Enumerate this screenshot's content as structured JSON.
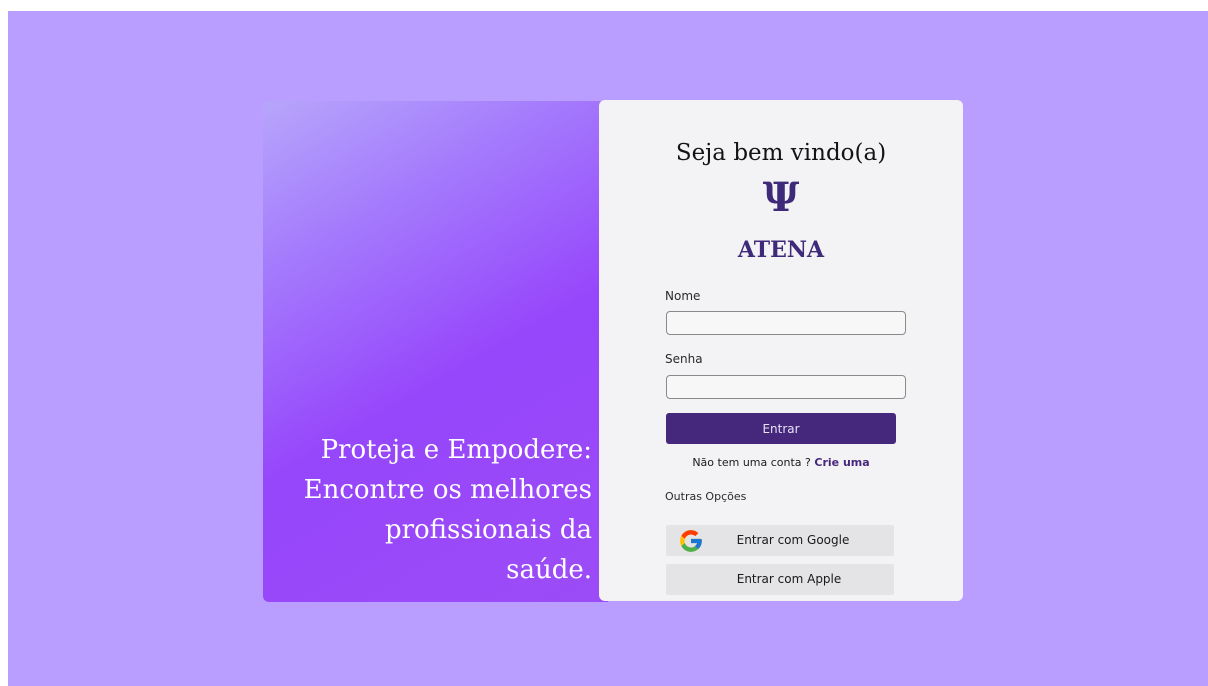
{
  "hero": {
    "tagline": "Proteja e Empodere: Encontre os melhores profissionais da saúde."
  },
  "login": {
    "title": "Seja bem vindo(a)",
    "logo_symbol": "Ψ",
    "brand_name": "ATENA",
    "name_label": "Nome",
    "name_value": "",
    "password_label": "Senha",
    "password_value": "",
    "submit_label": "Entrar",
    "signup_prompt": "Não tem uma conta ?",
    "signup_link": "Crie uma",
    "other_options_label": "Outras Opções",
    "google_label": "Entrar com Google",
    "apple_label": "Entrar com Apple"
  },
  "colors": {
    "page_background": "#b99eff",
    "brand_purple": "#45287b",
    "card_background": "#f3f2f4"
  }
}
